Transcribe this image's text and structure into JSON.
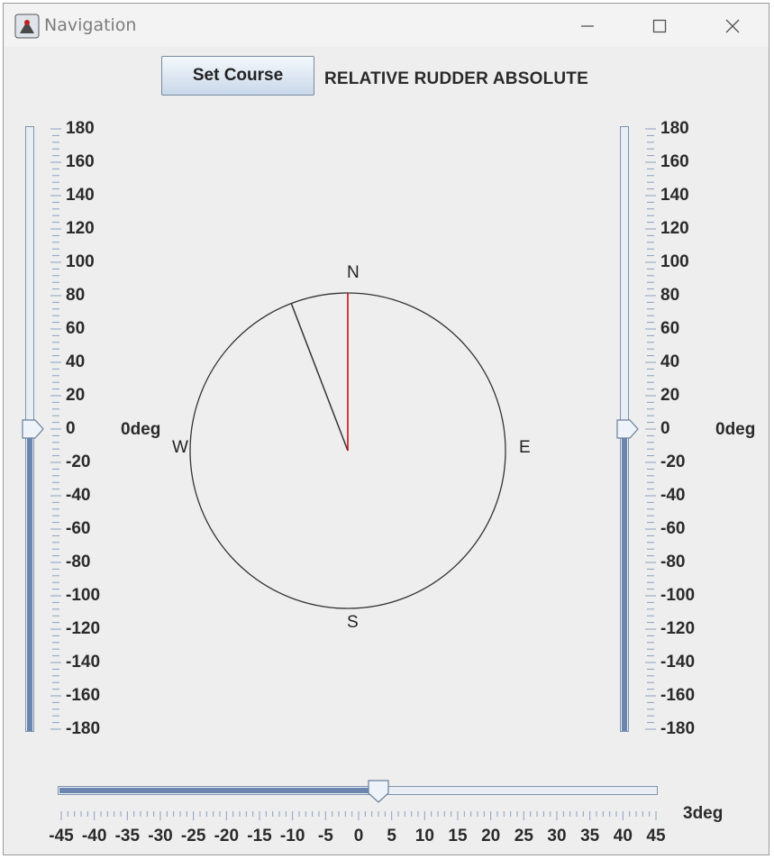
{
  "window": {
    "title": "Navigation"
  },
  "toolbar": {
    "set_course_label": "Set Course",
    "mode_label": "RELATIVE RUDDER ABSOLUTE"
  },
  "left_slider": {
    "min": -180,
    "max": 180,
    "value": 0,
    "readout": "0deg",
    "ticks": [
      "180",
      "160",
      "140",
      "120",
      "100",
      "80",
      "60",
      "40",
      "20",
      "0",
      "-20",
      "-40",
      "-60",
      "-80",
      "-100",
      "-120",
      "-140",
      "-160",
      "-180"
    ]
  },
  "right_slider": {
    "min": -180,
    "max": 180,
    "value": 0,
    "readout": "0deg",
    "ticks": [
      "180",
      "160",
      "140",
      "120",
      "100",
      "80",
      "60",
      "40",
      "20",
      "0",
      "-20",
      "-40",
      "-60",
      "-80",
      "-100",
      "-120",
      "-140",
      "-160",
      "-180"
    ]
  },
  "compass": {
    "labels": {
      "n": "N",
      "s": "S",
      "e": "E",
      "w": "W"
    },
    "course_needle_heading_deg": 0,
    "needle_color": "#d00000",
    "heading_line_deg": -21
  },
  "rudder_slider": {
    "min": -45,
    "max": 45,
    "value": 3,
    "readout": "3deg",
    "labels": [
      "-45",
      "-40",
      "-35",
      "-30",
      "-25",
      "-20",
      "-15",
      "-10",
      "-5",
      "0",
      "5",
      "10",
      "15",
      "20",
      "25",
      "30",
      "35",
      "40",
      "45"
    ]
  },
  "colors": {
    "track_fill": "#6a86ae",
    "needle": "#d00000",
    "window_bg": "#eeeeee"
  }
}
